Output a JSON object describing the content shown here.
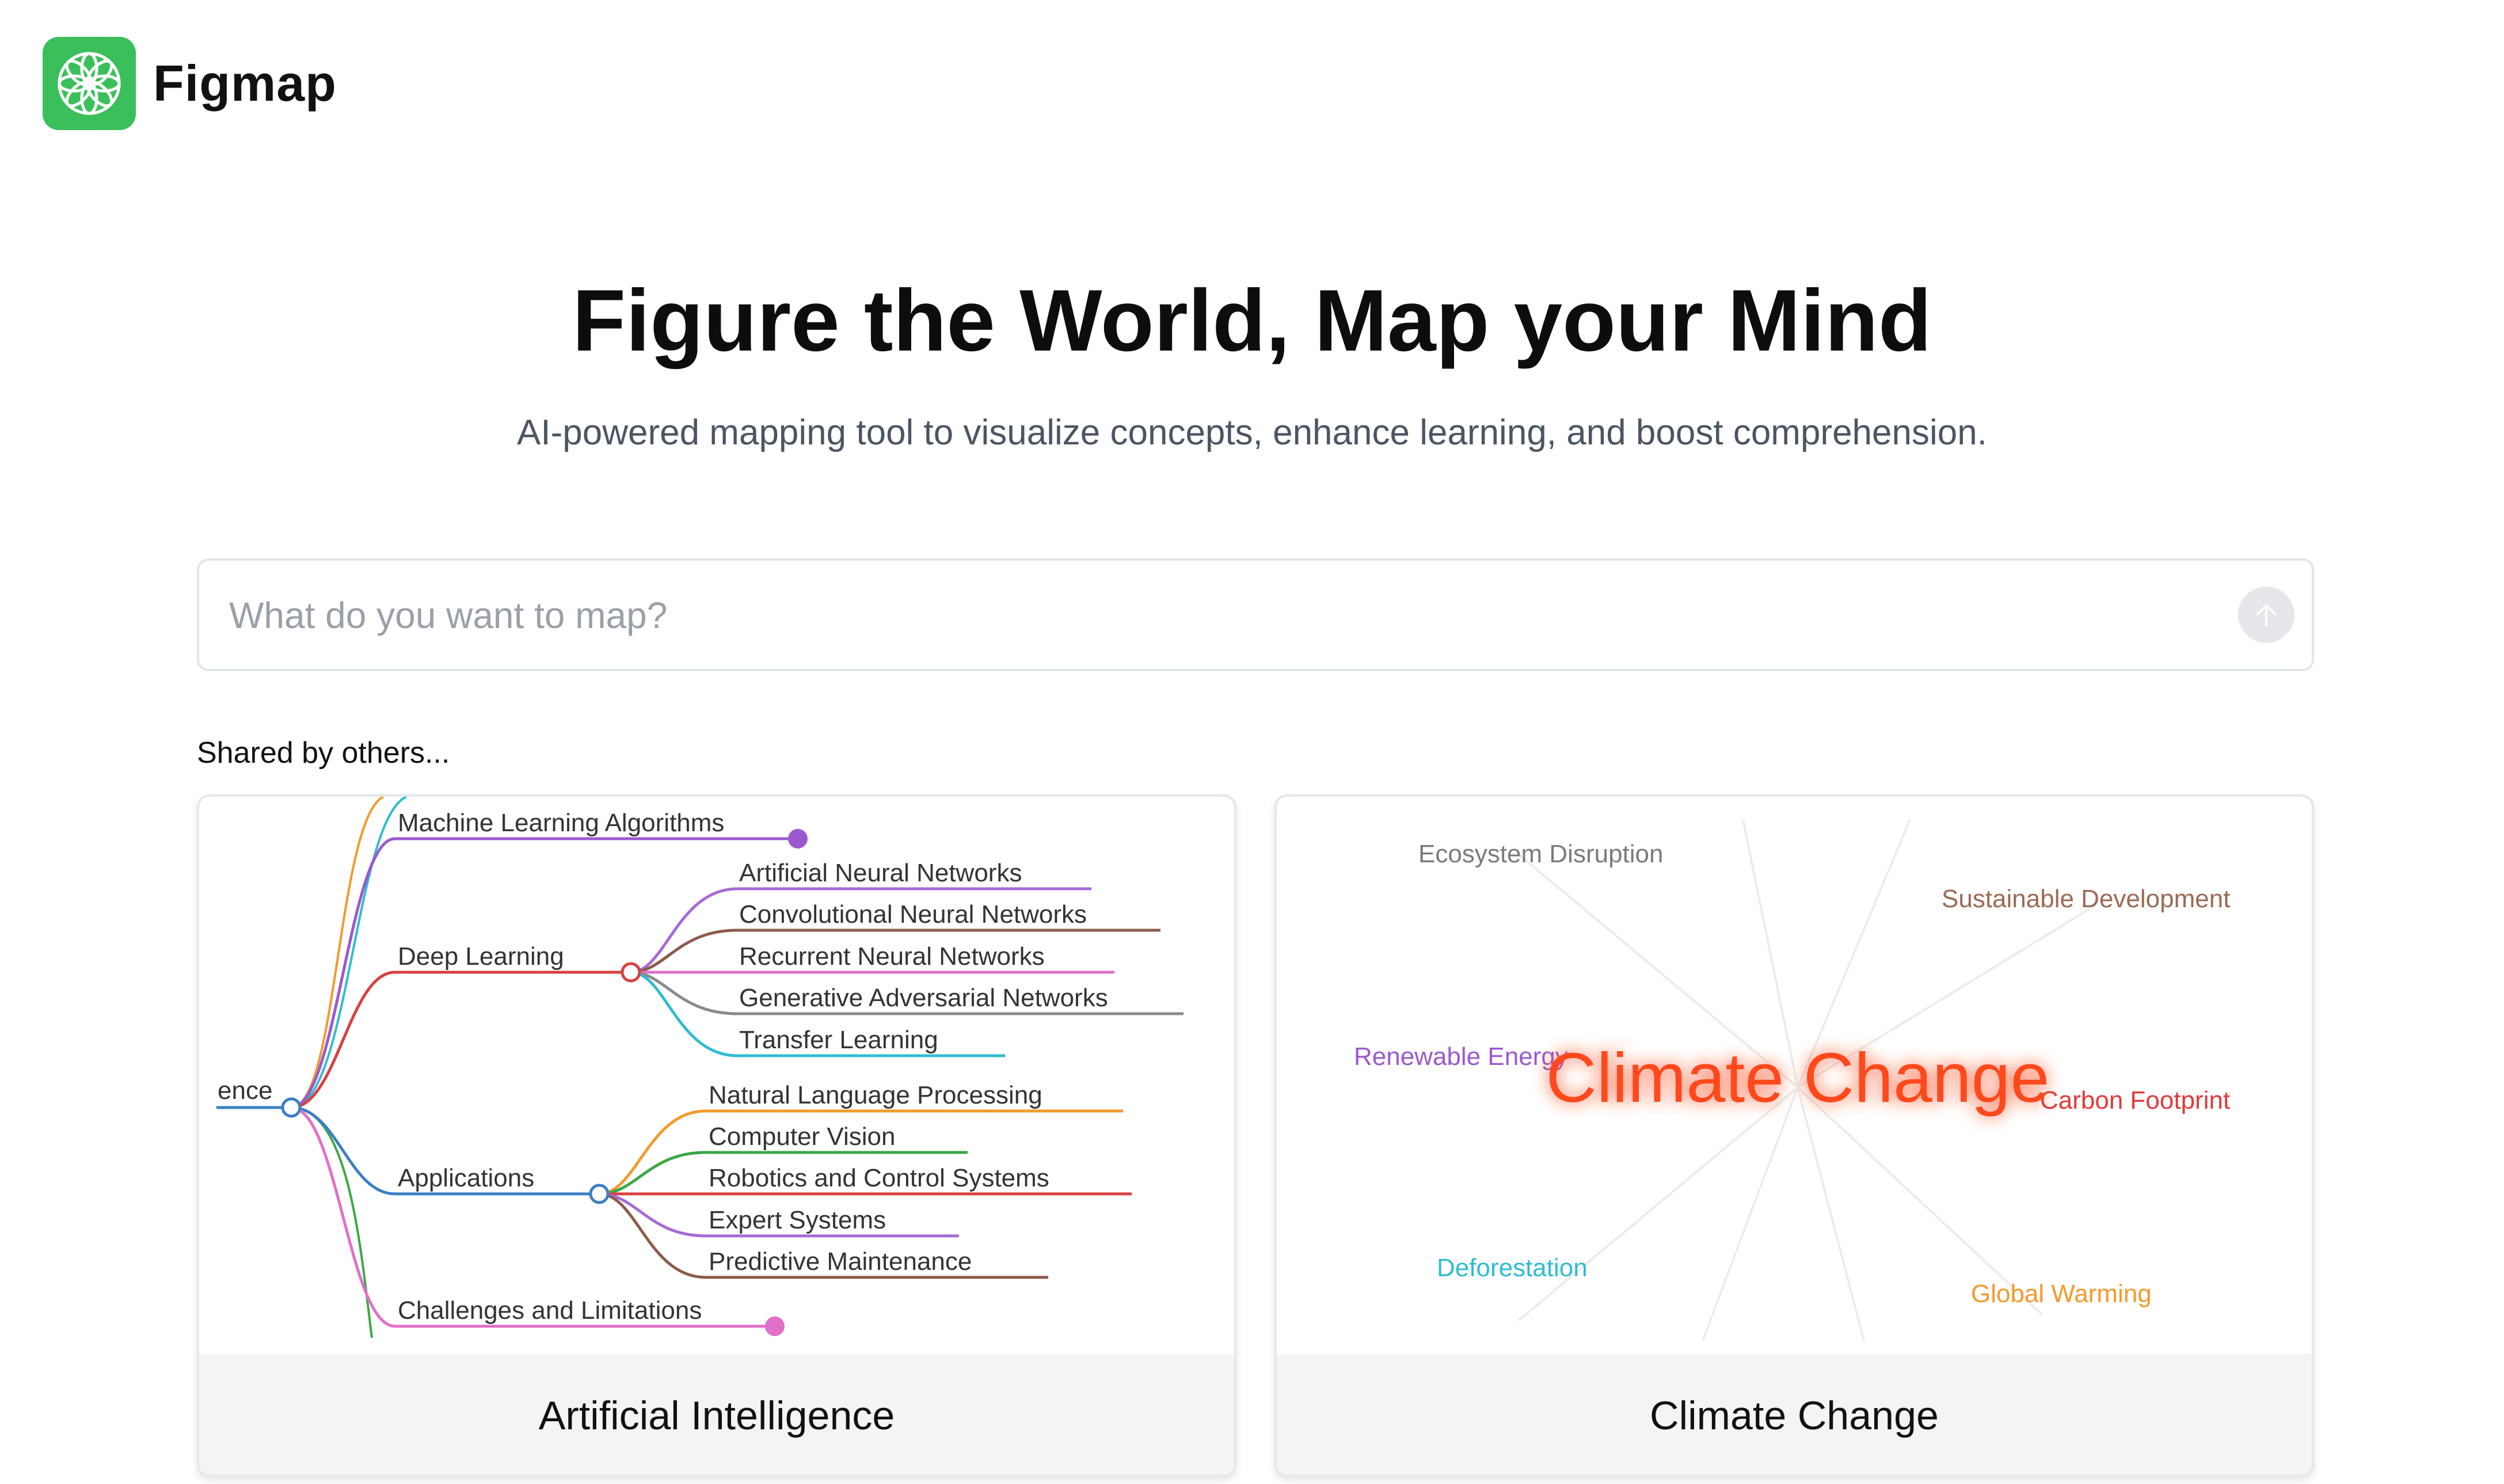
{
  "brand": {
    "name": "Figmap",
    "logo_icon": "flower-icon",
    "logo_color": "#3bbf5a"
  },
  "hero": {
    "title": "Figure the World, Map your Mind",
    "subtitle": "AI-powered mapping tool to visualize concepts, enhance learning, and boost comprehension."
  },
  "search": {
    "placeholder": "What do you want to map?",
    "value": "",
    "submit_icon": "arrow-up-icon"
  },
  "shared": {
    "label": "Shared by others...",
    "cards": [
      {
        "title": "Artificial Intelligence",
        "preview": {
          "root": "ence",
          "branches": [
            {
              "label": "Machine Learning Algorithms",
              "color": "#9b59d0",
              "children": []
            },
            {
              "label": "Deep Learning",
              "color": "#d94040",
              "children": [
                {
                  "label": "Artificial Neural Networks",
                  "color": "#a66ad6"
                },
                {
                  "label": "Convolutional Neural Networks",
                  "color": "#8d5a4a"
                },
                {
                  "label": "Recurrent Neural Networks",
                  "color": "#e26fc8"
                },
                {
                  "label": "Generative Adversarial Networks",
                  "color": "#8a8a8a"
                },
                {
                  "label": "Transfer Learning",
                  "color": "#2fbcd0"
                }
              ]
            },
            {
              "label": "Applications",
              "color": "#3a7fc4",
              "children": [
                {
                  "label": "Natural Language Processing",
                  "color": "#f39a2c"
                },
                {
                  "label": "Computer Vision",
                  "color": "#3aa845"
                },
                {
                  "label": "Robotics and Control Systems",
                  "color": "#d94040"
                },
                {
                  "label": "Expert Systems",
                  "color": "#a66ad6"
                },
                {
                  "label": "Predictive Maintenance",
                  "color": "#8d5a4a"
                }
              ]
            },
            {
              "label": "Challenges and Limitations",
              "color": "#e26fc8",
              "children": []
            }
          ]
        }
      },
      {
        "title": "Climate Change",
        "preview": {
          "center": "Climate Change",
          "center_color": "#ff4a1a",
          "terms": [
            {
              "label": "Ecosystem Disruption",
              "color": "#7b7b7b"
            },
            {
              "label": "Sustainable Development",
              "color": "#9b6a55"
            },
            {
              "label": "Renewable Energy",
              "color": "#9b59d0"
            },
            {
              "label": "Carbon Footprint",
              "color": "#e03a3a"
            },
            {
              "label": "Deforestation",
              "color": "#2fbcd0"
            },
            {
              "label": "Global Warming",
              "color": "#f39a2c"
            }
          ]
        }
      }
    ]
  }
}
